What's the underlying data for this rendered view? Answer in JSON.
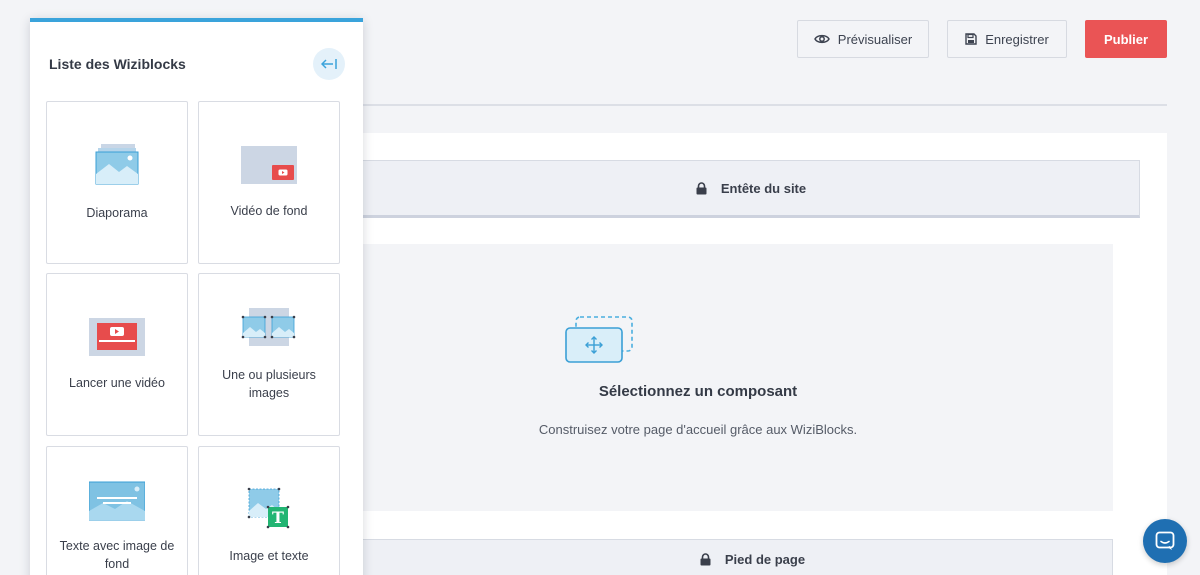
{
  "toolbar": {
    "preview_label": "Prévisualiser",
    "save_label": "Enregistrer",
    "publish_label": "Publier"
  },
  "panel": {
    "title": "Liste des Wiziblocks",
    "blocks": [
      {
        "label": "Diaporama",
        "icon": "slideshow-icon"
      },
      {
        "label": "Vidéo de fond",
        "icon": "background-video-icon"
      },
      {
        "label": "Lancer une vidéo",
        "icon": "launch-video-icon"
      },
      {
        "label": "Une ou plusieurs images",
        "icon": "multiple-images-icon"
      },
      {
        "label": "Texte avec image de fond",
        "icon": "text-background-image-icon"
      },
      {
        "label": "Image et texte",
        "icon": "image-and-text-icon"
      }
    ]
  },
  "canvas": {
    "header_label": "Entête du site",
    "empty_title": "Sélectionnez un composant",
    "empty_subtitle": "Construisez votre page d'accueil grâce aux WiziBlocks.",
    "footer_label": "Pied de page"
  },
  "colors": {
    "accent": "#3aa3db",
    "publish": "#ea5455",
    "chat": "#1f6fb2"
  }
}
